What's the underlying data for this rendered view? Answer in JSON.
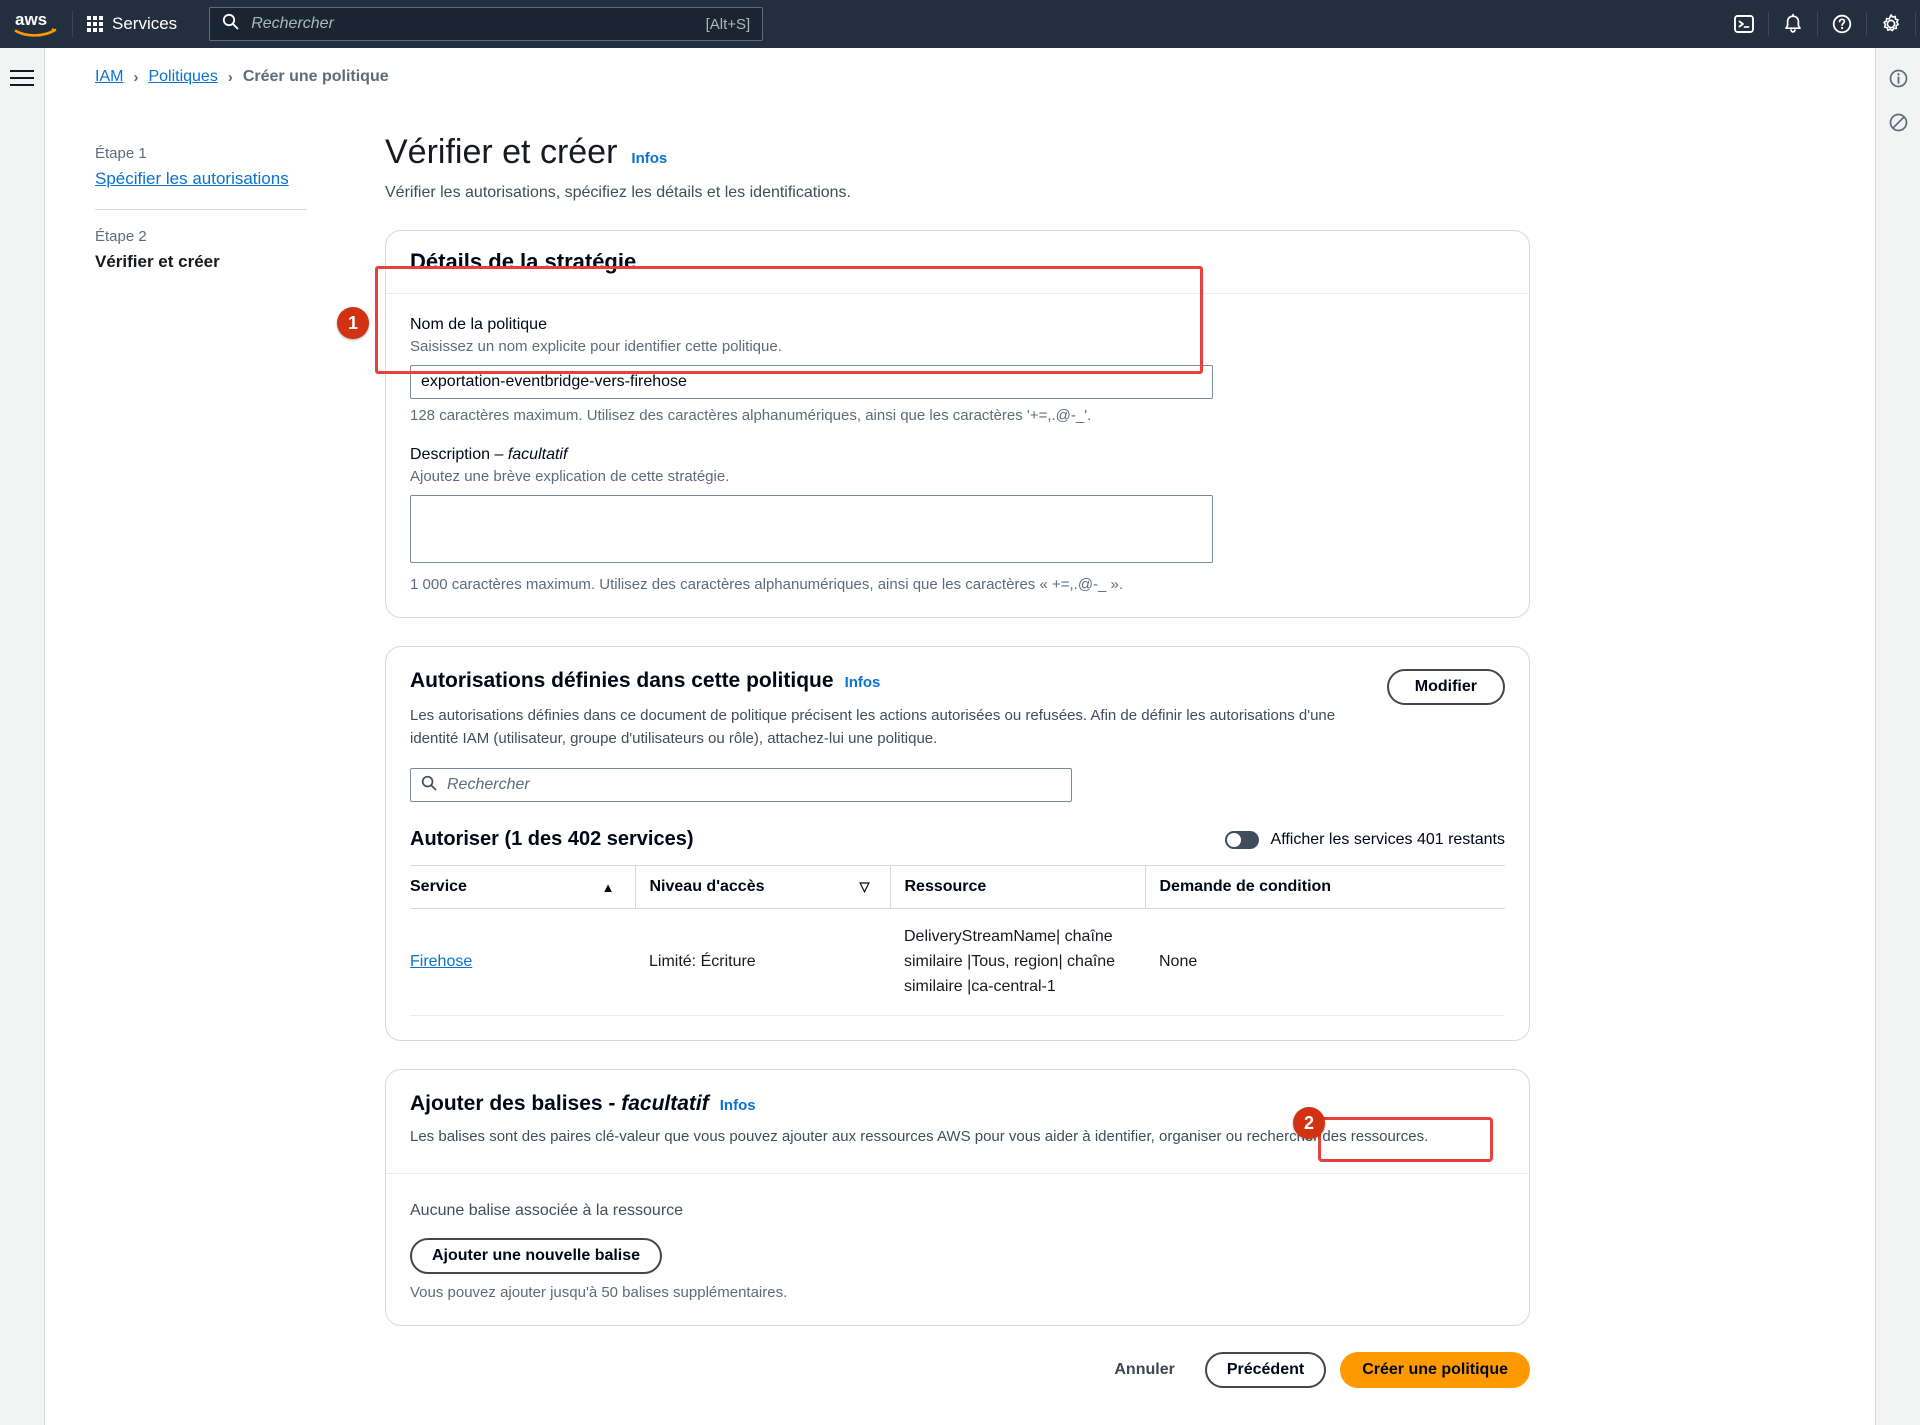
{
  "topnav": {
    "logo_alt": "aws",
    "services_label": "Services",
    "search_placeholder": "Rechercher",
    "search_value": "",
    "search_shortcut": "[Alt+S]",
    "icons": [
      "cloudshell-icon",
      "notifications-bell-icon",
      "help-question-icon",
      "settings-gear-icon"
    ]
  },
  "breadcrumb": {
    "items": [
      {
        "label": "IAM",
        "link": true
      },
      {
        "label": "Politiques",
        "link": true
      },
      {
        "label": "Créer une politique",
        "link": false
      }
    ],
    "separator": "›"
  },
  "wizard": {
    "step1_label": "Étape 1",
    "step1_title": "Spécifier les autorisations",
    "step2_label": "Étape 2",
    "step2_title": "Vérifier et créer"
  },
  "page": {
    "title": "Vérifier et créer",
    "infos": "Infos",
    "subtitle": "Vérifier les autorisations, spécifiez les détails et les identifications."
  },
  "details_card": {
    "title": "Détails de la stratégie",
    "name_label": "Nom de la politique",
    "name_hint": "Saisissez un nom explicite pour identifier cette politique.",
    "name_value": "exportation-eventbridge-vers-firehose",
    "name_placeholder": "",
    "name_footnote": "128 caractères maximum. Utilisez des caractères alphanumériques, ainsi que les caractères '+=,.@-_'.",
    "description_label": "Description –",
    "description_optional": "facultatif",
    "description_hint": "Ajoutez une brève explication de cette stratégie.",
    "description_value": "",
    "description_placeholder": "",
    "description_footnote": "1 000 caractères maximum. Utilisez des caractères alphanumériques, ainsi que les caractères « +=,.@-_ »."
  },
  "permissions_card": {
    "title": "Autorisations définies dans cette politique",
    "infos": "Infos",
    "description": "Les autorisations définies dans ce document de politique précisent les actions autorisées ou refusées. Afin de définir les autorisations d'une identité IAM (utilisateur, groupe d'utilisateurs ou rôle), attachez-lui une politique.",
    "modify_button": "Modifier",
    "search_placeholder": "Rechercher",
    "search_value": "",
    "allow_count": "Autoriser (1 des 402 services)",
    "toggle_label": "Afficher les services 401 restants",
    "toggle_on": false,
    "columns": [
      "Service",
      "Niveau d'accès",
      "Ressource",
      "Demande de condition"
    ],
    "sort_asc_icon": "▲",
    "sort_desc_icon": "▽",
    "rows": [
      {
        "service": "Firehose",
        "access_level": "Limité: Écriture",
        "resource_lines": [
          "DeliveryStreamName| chaîne",
          "similaire |Tous, region| chaîne",
          "similaire |ca-central-1"
        ],
        "condition": "None"
      }
    ]
  },
  "tags_card": {
    "title": "Ajouter des balises -",
    "title_optional": "facultatif",
    "infos": "Infos",
    "description": "Les balises sont des paires clé-valeur que vous pouvez ajouter aux ressources AWS pour vous aider à identifier, organiser ou rechercher des ressources.",
    "empty_text": "Aucune balise associée à la ressource",
    "add_button": "Ajouter une nouvelle balise",
    "note": "Vous pouvez ajouter jusqu'à 50 balises supplémentaires."
  },
  "footer": {
    "cancel": "Annuler",
    "previous": "Précédent",
    "create": "Créer une politique"
  },
  "annotations": {
    "badge_1": "1",
    "badge_2": "2",
    "highlight_color": "#e8403a",
    "badge_color": "#d13212"
  }
}
